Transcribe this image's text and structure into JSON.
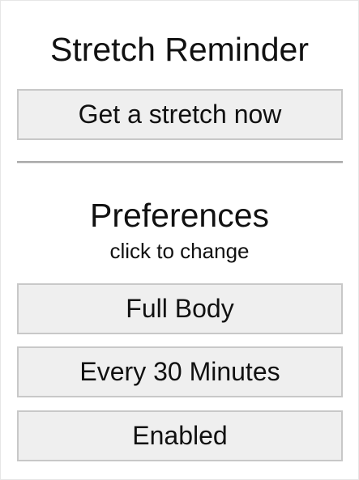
{
  "header": {
    "title": "Stretch Reminder"
  },
  "actions": {
    "stretch_now_label": "Get a stretch now"
  },
  "preferences": {
    "title": "Preferences",
    "subtitle": "click to change",
    "body_area": "Full Body",
    "frequency": "Every 30 Minutes",
    "status": "Enabled"
  },
  "colors": {
    "button_bg": "#efefef",
    "button_border": "#c8c8c8",
    "text": "#111111",
    "divider": "#a8a8a8"
  }
}
